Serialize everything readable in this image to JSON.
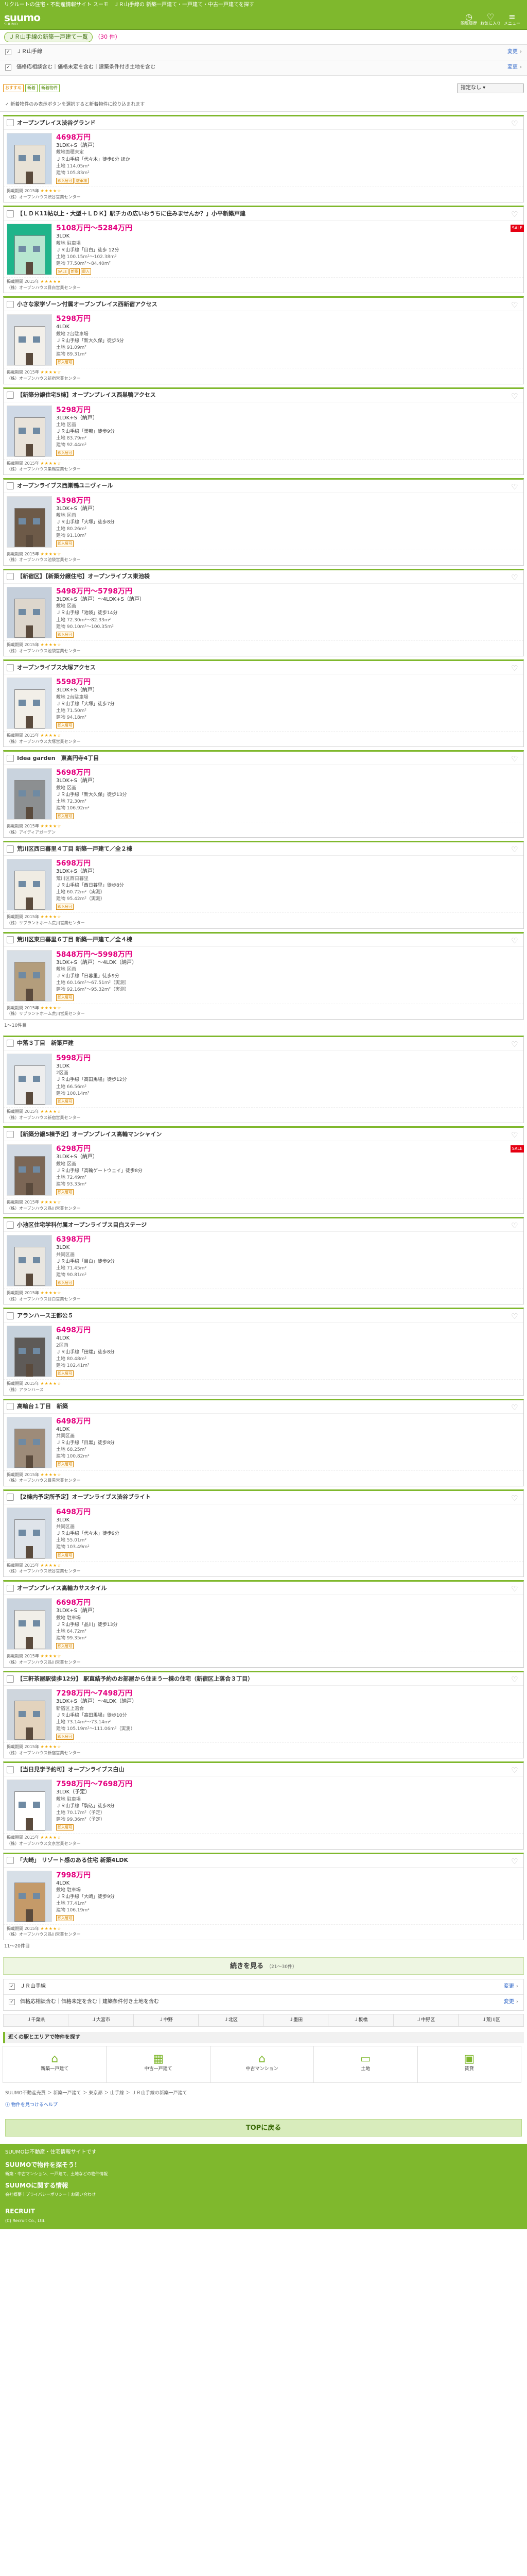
{
  "topline": "リクルートの住宅・不動産情報サイト スーモ　ＪＲ山手線の 新築一戸建て・一戸建て・中古一戸建てを探す",
  "header": {
    "logo": "suumo",
    "logo_sub": "SUUMO",
    "history": "閲覧履歴",
    "fav": "お気に入り",
    "menu": "メニュー"
  },
  "search_summary": {
    "label": "ＪＲ山手線の新築一戸建て一覧",
    "count": "（30 件）"
  },
  "conditions": [
    {
      "text": "ＪＲ山手線",
      "action": "変更"
    },
    {
      "text": "価格応相談含む｜価格未定を含む｜建築条件付き土地を含む",
      "action": "変更"
    }
  ],
  "toolbar": {
    "btn1": "おすすめ",
    "btn2": "新着",
    "btn3": "新着物件",
    "sort": "指定なし"
  },
  "notice": "新着物件のみ表示ボタンを選択すると新着物件に絞り込まれます",
  "listings": [
    {
      "title": "オープンプレイス渋谷グランド",
      "price": "4698万円",
      "layout": "3LDK+S（納戸）",
      "land": "敷地面積未定",
      "access": "ＪＲ山手線「代々木」徒歩8分 ほか",
      "area1": "土地 114.05m²",
      "area2": "建物 105.83m²",
      "tags": [
        "即入居可",
        "駐車場"
      ],
      "rating": "★★★★☆",
      "date": "掲載期間 2015年",
      "company": "（株）オープンハウス渋谷営業センター",
      "redtag": false,
      "img": "a"
    },
    {
      "title": "【ＬＤＫ11帖以上・大型＋ＬＤＫ】駅チカの広いおうちに住みませんか？」小平新築戸建",
      "price": "5108万円〜5284万円",
      "layout": "3LDK",
      "land": "敷地 駐車場",
      "access": "ＪＲ山手線「目白」徒歩 12分",
      "area1": "土地 100.15m²〜102.38m²",
      "area2": "建物 77.50m²〜84.40m²",
      "tags": [
        "SALE",
        "新築",
        "即入"
      ],
      "rating": "★★★★★",
      "date": "掲載期間 2015年",
      "company": "（株）オープンハウス目白営業センター",
      "redtag": true,
      "img": "b"
    },
    {
      "title": "小さな家学ゾーン付属オープンプレイス西新宿アクセス",
      "price": "5298万円",
      "layout": "4LDK",
      "land": "敷地 2台駐車場",
      "access": "ＪＲ山手線「新大久保」徒歩5分",
      "area1": "土地 91.09m²",
      "area2": "建物 89.31m²",
      "tags": [
        "即入居可"
      ],
      "rating": "★★★★☆",
      "date": "掲載期間 2015年",
      "company": "（株）オープンハウス新宿営業センター",
      "redtag": false,
      "img": "c"
    },
    {
      "title": "【新築分譲住宅5棟】オープンプレイス西巣鴨アクセス",
      "price": "5298万円",
      "layout": "3LDK+S（納戸）",
      "land": "土地 区画",
      "access": "ＪＲ山手線「巣鴨」徒歩9分",
      "area1": "土地 83.79m²",
      "area2": "建物 92.44m²",
      "tags": [
        "即入居可"
      ],
      "rating": "★★★★☆",
      "date": "掲載期間 2015年",
      "company": "（株）オープンハウス巣鴨営業センター",
      "redtag": false,
      "img": "d"
    },
    {
      "title": "オープンライブス西巣鴨ユニヴィール",
      "price": "5398万円",
      "layout": "3LDK+S（納戸）",
      "land": "敷地 区画",
      "access": "ＪＲ山手線「大塚」徒歩8分",
      "area1": "土地 80.26m²",
      "area2": "建物 91.10m²",
      "tags": [
        "即入居可"
      ],
      "rating": "★★★★☆",
      "date": "掲載期間 2015年",
      "company": "（株）オープンハウス池袋営業センター",
      "redtag": false,
      "img": "e"
    },
    {
      "title": "【新宿区】【新築分譲住宅】オープンライブス東池袋",
      "price": "5498万円〜5798万円",
      "layout": "3LDK+S（納戸）〜4LDK+S（納戸）",
      "land": "敷地 区画",
      "access": "ＪＲ山手線「池袋」徒歩14分",
      "area1": "土地 72.30m²〜82.33m²",
      "area2": "建物 90.10m²〜100.35m²",
      "tags": [
        "即入居可"
      ],
      "rating": "★★★★☆",
      "date": "掲載期間 2015年",
      "company": "（株）オープンハウス池袋営業センター",
      "redtag": false,
      "img": "f"
    },
    {
      "title": "オープンライブス大塚アクセス",
      "price": "5598万円",
      "layout": "3LDK+S（納戸）",
      "land": "敷地 2台駐車場",
      "access": "ＪＲ山手線「大塚」徒歩7分",
      "area1": "土地 71.50m²",
      "area2": "建物 94.18m²",
      "tags": [
        "即入居可"
      ],
      "rating": "★★★★☆",
      "date": "掲載期間 2015年",
      "company": "（株）オープンハウス大塚営業センター",
      "redtag": false,
      "img": "g"
    },
    {
      "title": "Idea garden　東高円寺4丁目",
      "price": "5698万円",
      "layout": "3LDK+S（納戸）",
      "land": "敷地 区画",
      "access": "ＪＲ山手線「新大久保」徒歩13分",
      "area1": "土地 72.30m²",
      "area2": "建物 106.92m²",
      "tags": [
        "即入居可"
      ],
      "rating": "★★★★☆",
      "date": "掲載期間 2015年",
      "company": "（株）アイディアガーデン",
      "redtag": false,
      "img": "h"
    },
    {
      "title": "荒川区西日暮里４丁目 新築一戸建て／全２棟",
      "price": "5698万円",
      "layout": "3LDK+S（納戸）",
      "land": "荒川区西日暮里",
      "access": "ＪＲ山手線「西日暮里」徒歩8分",
      "area1": "土地 60.72m²（実測）",
      "area2": "建物 95.42m²（実測）",
      "tags": [
        "即入居可"
      ],
      "rating": "★★★★☆",
      "date": "掲載期間 2015年",
      "company": "（株）リブラントホーム荒川営業センター",
      "redtag": false,
      "img": "i"
    },
    {
      "title": "荒川区東日暮里６丁目 新築一戸建て／全４棟",
      "price": "5848万円〜5998万円",
      "layout": "3LDK+S（納戸）〜4LDK（納戸）",
      "land": "敷地 区画",
      "access": "ＪＲ山手線「日暮里」徒歩9分",
      "area1": "土地 60.16m²〜67.51m²（実測）",
      "area2": "建物 92.16m²〜95.32m²（実測）",
      "tags": [
        "即入居可"
      ],
      "rating": "★★★★☆",
      "date": "掲載期間 2015年",
      "company": "（株）リブラントホーム荒川営業センター",
      "redtag": false,
      "img": "j"
    }
  ],
  "pagenote": "1〜10件目",
  "listings2": [
    {
      "title": "中落３丁目　新築戸建",
      "price": "5998万円",
      "layout": "3LDK",
      "land": "2区画",
      "access": "ＪＲ山手線「高田馬場」徒歩12分",
      "area1": "土地 66.56m²",
      "area2": "建物 100.14m²",
      "tags": [
        "即入居可"
      ],
      "rating": "★★★★☆",
      "date": "掲載期間 2015年",
      "company": "（株）オープンハウス新宿営業センター",
      "redtag": false,
      "img": "k"
    },
    {
      "title": "【新築分譲5棟予定】オープンプレイス高輪マンシャイン",
      "price": "6298万円",
      "layout": "3LDK+S（納戸）",
      "land": "敷地 区画",
      "access": "ＪＲ山手線「高輪ゲートウェイ」徒歩8分",
      "area1": "土地 72.49m²",
      "area2": "建物 93.33m²",
      "tags": [
        "即入居可"
      ],
      "rating": "★★★★☆",
      "date": "掲載期間 2015年",
      "company": "（株）オープンハウス品川営業センター",
      "redtag": true,
      "img": "l"
    },
    {
      "title": "小池区住宅学科付属オープンライブス目白ステージ",
      "price": "6398万円",
      "layout": "3LDK",
      "land": "共同区画",
      "access": "ＪＲ山手線「目白」徒歩9分",
      "area1": "土地 71.45m²",
      "area2": "建物 90.81m²",
      "tags": [
        "即入居可"
      ],
      "rating": "★★★★☆",
      "date": "掲載期間 2015年",
      "company": "（株）オープンハウス目白営業センター",
      "redtag": false,
      "img": "m"
    },
    {
      "title": "アランハース王都公５",
      "price": "6498万円",
      "layout": "4LDK",
      "land": "2区画",
      "access": "ＪＲ山手線「田端」徒歩8分",
      "area1": "土地 80.48m²",
      "area2": "建物 102.41m²",
      "tags": [
        "即入居可"
      ],
      "rating": "★★★★☆",
      "date": "掲載期間 2015年",
      "company": "（株）アランハース",
      "redtag": false,
      "img": "n"
    },
    {
      "title": "高輪台１丁目　新築",
      "price": "6498万円",
      "layout": "4LDK",
      "land": "共同区画",
      "access": "ＪＲ山手線「目黒」徒歩8分",
      "area1": "土地 68.25m²",
      "area2": "建物 100.82m²",
      "tags": [
        "即入居可"
      ],
      "rating": "★★★★☆",
      "date": "掲載期間 2015年",
      "company": "（株）オープンハウス目黒営業センター",
      "redtag": false,
      "img": "o"
    },
    {
      "title": "【2棟内予定所予定】オープンライブス渋谷ブライト",
      "price": "6498万円",
      "layout": "3LDK",
      "land": "共同区画",
      "access": "ＪＲ山手線「代々木」徒歩9分",
      "area1": "土地 55.01m²",
      "area2": "建物 103.49m²",
      "tags": [
        "即入居可"
      ],
      "rating": "★★★★☆",
      "date": "掲載期間 2015年",
      "company": "（株）オープンハウス渋谷営業センター",
      "redtag": false,
      "img": "p"
    },
    {
      "title": "オープンプレイス高輪カサスタイル",
      "price": "6698万円",
      "layout": "3LDK+S（納戸）",
      "land": "敷地 駐車場",
      "access": "ＪＲ山手線「品川」徒歩13分",
      "area1": "土地 64.72m²",
      "area2": "建物 99.35m²",
      "tags": [
        "即入居可"
      ],
      "rating": "★★★★☆",
      "date": "掲載期間 2015年",
      "company": "（株）オープンハウス品川営業センター",
      "redtag": false,
      "img": "q"
    },
    {
      "title": "【三軒茶屋駅徒歩12分】 駅直結予約のお部屋から住まう一棟の住宅（新宿区上落合３丁目）",
      "price": "7298万円〜7498万円",
      "layout": "3LDK+S（納戸）〜4LDK（納戸）",
      "land": "新宿区上落合",
      "access": "ＪＲ山手線「高田馬場」徒歩10分",
      "area1": "土地 73.14m²〜73.14m²",
      "area2": "建物 105.19m²〜111.06m²（実測）",
      "tags": [
        "即入居可"
      ],
      "rating": "★★★★☆",
      "date": "掲載期間 2015年",
      "company": "（株）オープンハウス新宿営業センター",
      "redtag": false,
      "img": "r"
    },
    {
      "title": "【当日見学予約可】オープンライブス白山",
      "price": "7598万円〜7698万円",
      "layout": "3LDK（予定）",
      "land": "敷地 駐車場",
      "access": "ＪＲ山手線「駒込」徒歩8分",
      "area1": "土地 70.17m²（予定）",
      "area2": "建物 99.36m²（予定）",
      "tags": [
        "即入居可"
      ],
      "rating": "★★★★☆",
      "date": "掲載期間 2015年",
      "company": "（株）オープンハウス文京営業センター",
      "redtag": false,
      "img": "s"
    },
    {
      "title": "「大崎」 リゾート感のある住宅 新築4LDK",
      "price": "7998万円",
      "layout": "4LDK",
      "land": "敷地 駐車場",
      "access": "ＪＲ山手線「大崎」徒歩9分",
      "area1": "土地 77.41m²",
      "area2": "建物 106.19m²",
      "tags": [
        "即入居可"
      ],
      "rating": "★★★★☆",
      "date": "掲載期間 2015年",
      "company": "（株）オープンハウス品川営業センター",
      "redtag": false,
      "img": "t"
    }
  ],
  "pagenote2": "11〜20件目",
  "loadmore": {
    "label": "続きを見る",
    "sub": "（21〜30件）"
  },
  "categories": [
    "Ｊ千葉県",
    "Ｊ大宮市",
    "Ｊ中野",
    "Ｊ北区",
    "Ｊ墨田",
    "Ｊ板橋",
    "Ｊ中野区",
    "Ｊ荒川区"
  ],
  "section_title": "近くの駅とエリアで物件を探す",
  "icon_boxes": [
    {
      "icon": "⌂",
      "label": "新築一戸建て"
    },
    {
      "icon": "▦",
      "label": "中古一戸建て"
    },
    {
      "icon": "⌂",
      "label": "中古マンション"
    },
    {
      "icon": "▭",
      "label": "土地"
    },
    {
      "icon": "▣",
      "label": "賃貸"
    }
  ],
  "crumbs": "SUUMO不動産売買 ＞ 新築一戸建て ＞ 東京都 ＞ 山手線 ＞ ＪＲ山手線の新築一戸建て",
  "help": "物件を見つけるヘルプ",
  "totop": "TOPに戻る",
  "footer": {
    "line1": "SUUMOは不動産・住宅情報サイトです",
    "h1": "SUUMOで物件を探そう！",
    "p1": "新築・中古マンション、一戸建て、土地などの物件情報",
    "h2": "SUUMOに関する情報",
    "p2": "会社概要｜プライバシーポリシー｜お問い合わせ",
    "logo": "RECRUIT",
    "copy": "(C) Recruit Co., Ltd."
  },
  "colors": {
    "brand": "#7fb82d",
    "price": "#e4007f",
    "link": "#2a63c7"
  }
}
